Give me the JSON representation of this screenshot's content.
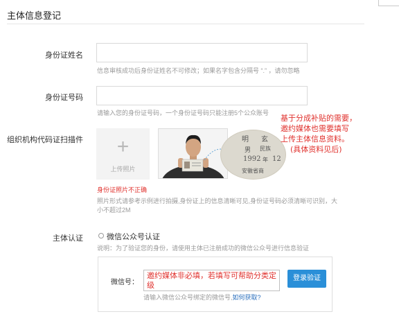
{
  "page": {
    "title": "主体信息登记"
  },
  "form": {
    "name": {
      "label": "身份证姓名",
      "hint": "信息审核成功后身份证姓名不可修改；如果名字包含分隔号 “.” ，请勿忽略"
    },
    "id_number": {
      "label": "身份证号码",
      "hint": "请输入您的身份证号码，一个身份证号码只能注册5个公众账号"
    },
    "scan": {
      "label": "组织机构代码证扫描件",
      "upload_label": "上传照片",
      "error": "身份证照片不正确",
      "hint_line1": "照片形式请参考示例进行拍摄,身份证上的信息清晰可见,身份证号码必须清晰可识别，大",
      "hint_line2": "小不超过2M",
      "sample_card": {
        "name_char": "明",
        "name_char2": "玄",
        "sex": "男",
        "nation": "民族",
        "year": "1992",
        "month": "年",
        "day": "12",
        "address": "安徽省商"
      }
    },
    "verify": {
      "label": "主体认证",
      "option": "微信公众号认证",
      "hint": "说明：为了验证您的身份，请使用主体已注册成功的微信公众号进行信息验证",
      "wechat_label": "微信号：",
      "button": "登录验证",
      "sub_hint_prefix": "请输入微信公众号绑定的微信号,",
      "sub_hint_link": "如何获取?"
    }
  },
  "annotations": {
    "note1": [
      "基于分成补贴的需要，",
      "邀约媒体也需要填写",
      "上传主体信息资料。",
      "(具体资料见后)"
    ],
    "note2": "邀约媒体非必填，若填写可帮助分类定级"
  },
  "colors": {
    "accent": "#2a8fd8",
    "error": "#e0312d"
  }
}
